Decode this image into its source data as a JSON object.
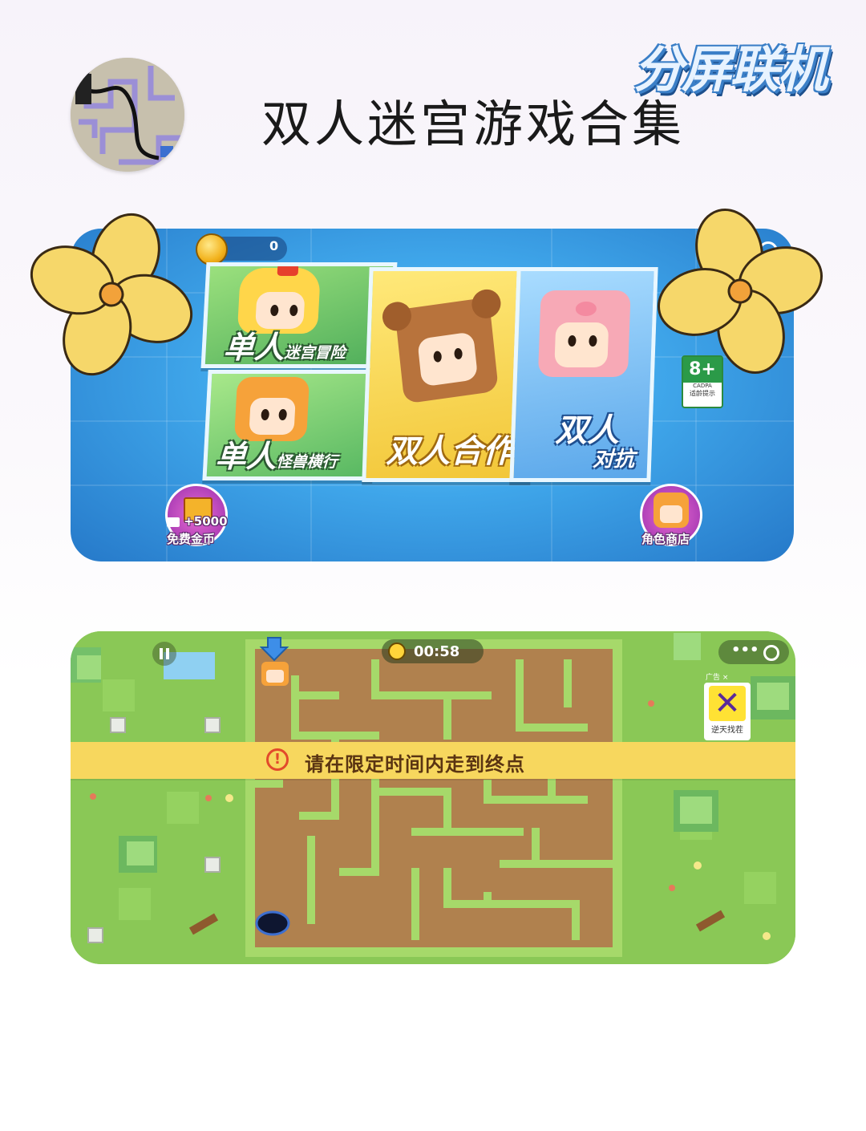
{
  "header": {
    "title": "双人迷宫游戏合集",
    "tag": "分屏联机"
  },
  "menu_screen": {
    "coin_count": "0",
    "cards": {
      "single_maze": {
        "main": "单人",
        "sub": "迷宫冒险"
      },
      "single_monster": {
        "main": "单人",
        "sub": "怪兽横行"
      },
      "coop": {
        "main": "双人合作"
      },
      "versus": {
        "main": "双人",
        "sub": "对抗"
      }
    },
    "age_badge": {
      "age": "8+",
      "org": "CADPA",
      "note": "适龄提示"
    },
    "free_coins": {
      "amount": "+5000",
      "label": "免费金币"
    },
    "shop_label": "角色商店"
  },
  "maze_screen": {
    "timer": "00:58",
    "notice": "请在限定时间内走到终点",
    "ad": {
      "mark": "广告 ×",
      "name": "逆天找茬"
    },
    "menu_dots": "•••"
  },
  "colors": {
    "menu_bg": "#3fa6ea",
    "card_green": "#6cc26c",
    "card_yellow": "#f4d148",
    "card_blue": "#6ab6ee",
    "grass": "#8ac856",
    "maze_floor": "#b0814e",
    "maze_wall": "#a6d96a",
    "banner": "#f7d75e"
  },
  "icons": [
    "coin-icon",
    "settings-icon",
    "gift-icon",
    "video-icon",
    "pause-icon",
    "clock-icon",
    "warning-icon",
    "blue-arrow-icon",
    "black-hole-icon",
    "flower-icon"
  ]
}
